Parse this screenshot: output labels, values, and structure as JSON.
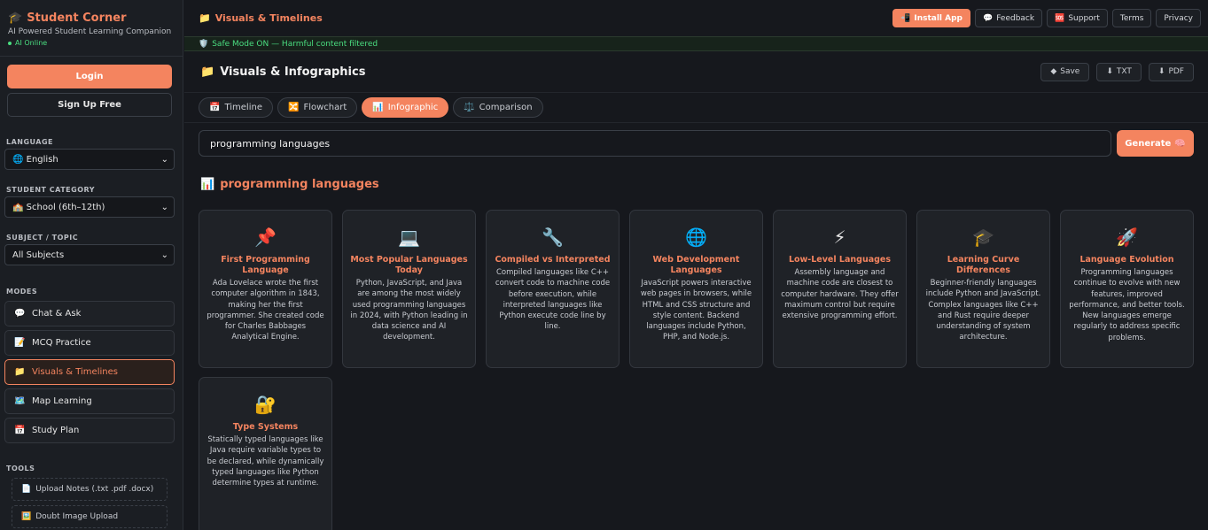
{
  "sidebar": {
    "brand": "Student Corner",
    "subtitle": "AI Powered Student Learning Companion",
    "status": "AI Online",
    "login": "Login",
    "signup": "Sign Up Free",
    "language_label": "LANGUAGE",
    "language_value": "English",
    "category_label": "STUDENT CATEGORY",
    "category_value": "School (6th–12th)",
    "subject_label": "SUBJECT / TOPIC",
    "subject_value": "All Subjects",
    "modes_label": "MODES",
    "modes": [
      {
        "icon": "💬",
        "label": "Chat & Ask"
      },
      {
        "icon": "📝",
        "label": "MCQ Practice"
      },
      {
        "icon": "📁",
        "label": "Visuals & Timelines"
      },
      {
        "icon": "🗺️",
        "label": "Map Learning"
      },
      {
        "icon": "📅",
        "label": "Study Plan"
      }
    ],
    "tools_label": "TOOLS",
    "tools": [
      {
        "icon": "📄",
        "label": "Upload Notes (.txt .pdf .docx)"
      },
      {
        "icon": "🖼️",
        "label": "Doubt Image Upload"
      }
    ]
  },
  "topbar": {
    "title": "Visuals & Timelines",
    "install": "Install App",
    "feedback": "Feedback",
    "support": "Support",
    "terms": "Terms",
    "privacy": "Privacy"
  },
  "safe_mode": "Safe Mode ON — Harmful content filtered",
  "visuals": {
    "title": "Visuals & Infographics",
    "save": "Save",
    "txt": "TXT",
    "pdf": "PDF",
    "tabs": [
      {
        "icon": "📅",
        "label": "Timeline"
      },
      {
        "icon": "🔀",
        "label": "Flowchart"
      },
      {
        "icon": "📊",
        "label": "Infographic"
      },
      {
        "icon": "⚖️",
        "label": "Comparison"
      }
    ],
    "input_value": "programming languages",
    "generate": "Generate",
    "section_title": "programming languages",
    "cards": [
      {
        "icon": "📌",
        "title": "First Programming Language",
        "desc": "Ada Lovelace wrote the first computer algorithm in 1843, making her the first programmer. She created code for Charles Babbages Analytical Engine."
      },
      {
        "icon": "💻",
        "title": "Most Popular Languages Today",
        "desc": "Python, JavaScript, and Java are among the most widely used programming languages in 2024, with Python leading in data science and AI development."
      },
      {
        "icon": "🔧",
        "title": "Compiled vs Interpreted",
        "desc": "Compiled languages like C++ convert code to machine code before execution, while interpreted languages like Python execute code line by line."
      },
      {
        "icon": "🌐",
        "title": "Web Development Languages",
        "desc": "JavaScript powers interactive web pages in browsers, while HTML and CSS structure and style content. Backend languages include Python, PHP, and Node.js."
      },
      {
        "icon": "⚡",
        "title": "Low-Level Languages",
        "desc": "Assembly language and machine code are closest to computer hardware. They offer maximum control but require extensive programming effort."
      },
      {
        "icon": "🎓",
        "title": "Learning Curve Differences",
        "desc": "Beginner-friendly languages include Python and JavaScript. Complex languages like C++ and Rust require deeper understanding of system architecture."
      },
      {
        "icon": "🚀",
        "title": "Language Evolution",
        "desc": "Programming languages continue to evolve with new features, improved performance, and better tools. New languages emerge regularly to address specific problems."
      },
      {
        "icon": "🔐",
        "title": "Type Systems",
        "desc": "Statically typed languages like Java require variable types to be declared, while dynamically typed languages like Python determine types at runtime."
      }
    ]
  }
}
